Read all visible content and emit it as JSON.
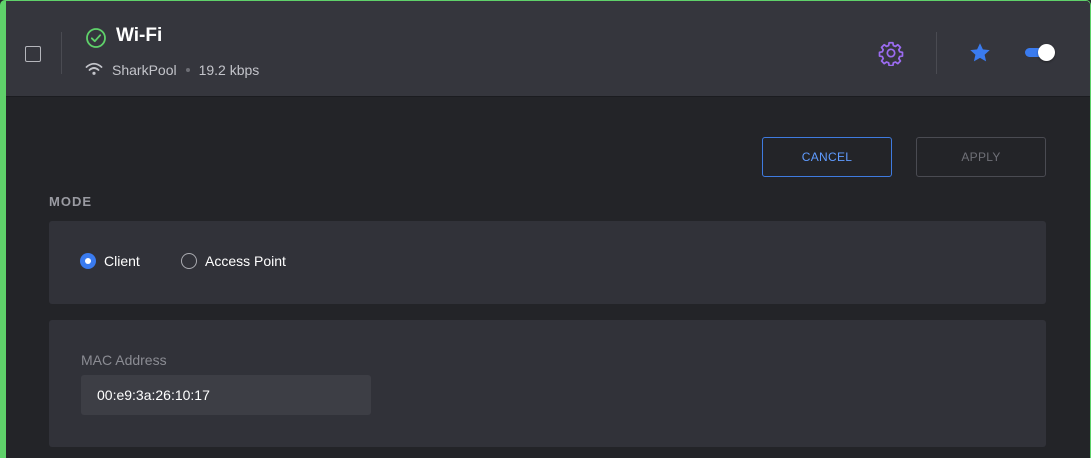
{
  "header": {
    "title": "Wi-Fi",
    "network_name": "SharkPool",
    "speed": "19.2 kbps",
    "status_icon": "check-circle-icon",
    "toggle_on": true,
    "favorite": true
  },
  "actions": {
    "cancel_label": "CANCEL",
    "apply_label": "APPLY"
  },
  "mode": {
    "label": "MODE",
    "options": [
      {
        "label": "Client",
        "selected": true
      },
      {
        "label": "Access Point",
        "selected": false
      }
    ]
  },
  "mac": {
    "label": "MAC Address",
    "value": "00:e9:3a:26:10:17"
  },
  "colors": {
    "accent": "#3a7bef",
    "success": "#5fd16a",
    "gear": "#9b6bf0"
  }
}
